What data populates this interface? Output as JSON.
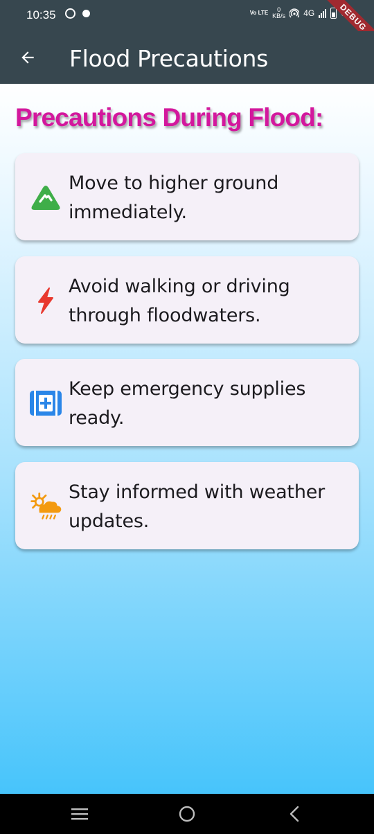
{
  "status_bar": {
    "time": "10:35",
    "volte": "Vo LTE",
    "speed_value": "0",
    "speed_unit": "KB/s",
    "network": "4G",
    "battery": "51",
    "debug_label": "DEBUG"
  },
  "app_bar": {
    "title": "Flood Precautions",
    "back_icon": "arrow-left-icon"
  },
  "content": {
    "heading": "Precautions During Flood:",
    "heading_color": "#d3189d",
    "precautions": [
      {
        "icon": "terrain-icon",
        "icon_color": "#3fae49",
        "text": "Move to higher ground immediately."
      },
      {
        "icon": "lightning-icon",
        "icon_color": "#e8382e",
        "text": "Avoid walking or driving through floodwaters."
      },
      {
        "icon": "medical-kit-icon",
        "icon_color": "#2a86e8",
        "text": "Keep emergency supplies ready."
      },
      {
        "icon": "sun-rain-cloud-icon",
        "icon_color": "#f39a10",
        "text": "Stay informed with weather updates."
      }
    ]
  },
  "nav_bar": {
    "recents_icon": "recents-icon",
    "home_icon": "home-circle-icon",
    "back_icon": "back-chevron-icon"
  },
  "colors": {
    "app_bar_bg": "#37474f",
    "card_bg": "#f5f0f8",
    "gradient_bottom": "#47c4fb"
  }
}
